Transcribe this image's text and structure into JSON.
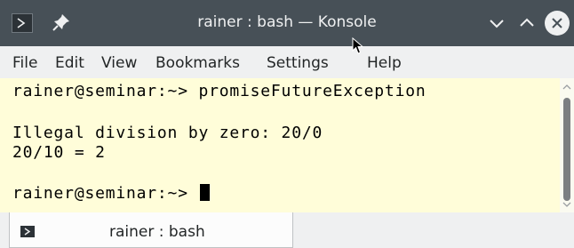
{
  "window": {
    "title": "rainer : bash — Konsole",
    "icons": [
      "terminal-app-icon",
      "pin-icon",
      "minimize-icon",
      "maximize-icon",
      "close-icon"
    ]
  },
  "menubar": {
    "items": [
      "File",
      "Edit",
      "View",
      "Bookmarks",
      "Settings",
      "Help"
    ]
  },
  "terminal": {
    "lines": [
      "rainer@seminar:~> promiseFutureException",
      "",
      "Illegal division by zero: 20/0",
      "20/10 = 2",
      "",
      "rainer@seminar:~> "
    ]
  },
  "tabs": [
    {
      "label": "rainer : bash",
      "icon": "terminal-tab-icon",
      "active": true
    }
  ],
  "colors": {
    "titlebar": "#475057",
    "terminal_background": "#fffdd9",
    "terminal_text": "#000000",
    "menubar": "#eff0f1"
  }
}
